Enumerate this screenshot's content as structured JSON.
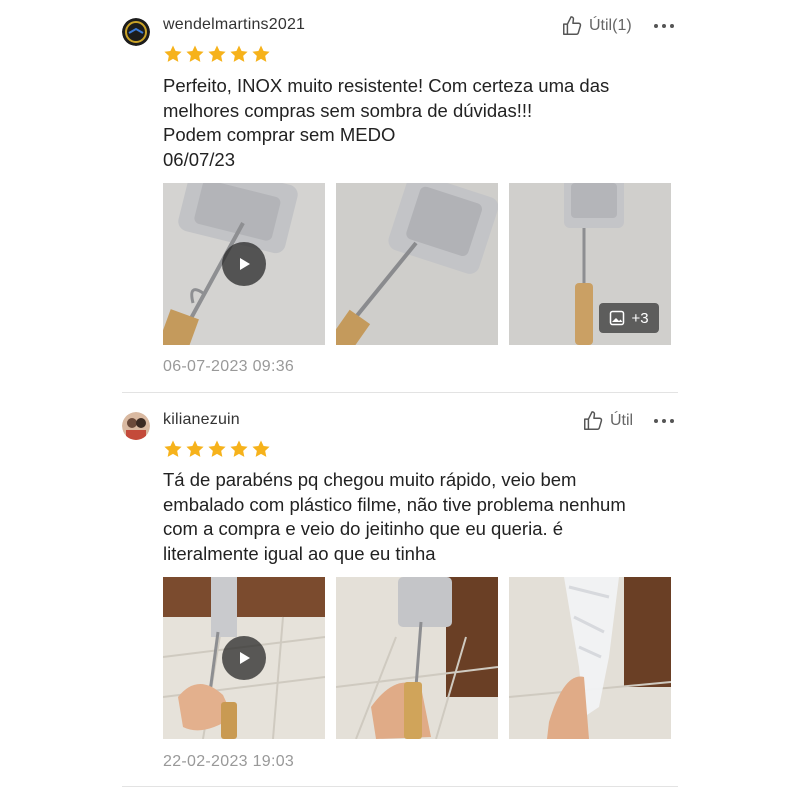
{
  "reviews": [
    {
      "username": "wendelmartins2021",
      "helpful_label": "Útil(1)",
      "rating": 5,
      "text_lines": [
        "Perfeito, INOX muito resistente! Com certeza uma das",
        "melhores compras sem sombra de dúvidas!!!",
        "Podem comprar sem MEDO",
        "06/07/23"
      ],
      "extra_photos_label": "+3",
      "date": "06-07-2023 09:36"
    },
    {
      "username": "kilianezuin",
      "helpful_label": "Útil",
      "rating": 5,
      "text_lines": [
        "Tá de parabéns pq chegou muito rápido, veio bem",
        "embalado com plástico filme, não tive problema nenhum",
        "com a compra e veio do jeitinho que eu queria. é",
        "literalmente igual ao que eu tinha"
      ],
      "date": "22-02-2023 19:03"
    }
  ],
  "colors": {
    "star": "#f6b21b",
    "date": "#999999",
    "divider": "#e3e3e3"
  },
  "icons": [
    "thumbs-up-icon",
    "more-options-icon",
    "star-icon",
    "play-icon",
    "image-icon"
  ]
}
